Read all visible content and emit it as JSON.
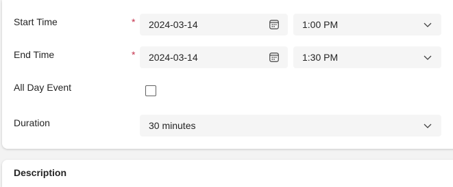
{
  "form": {
    "start_time": {
      "label": "Start Time",
      "required_mark": "*",
      "date": "2024-03-14",
      "time": "1:00 PM"
    },
    "end_time": {
      "label": "End Time",
      "required_mark": "*",
      "date": "2024-03-14",
      "time": "1:30 PM"
    },
    "all_day": {
      "label": "All Day Event",
      "checked": false
    },
    "duration": {
      "label": "Duration",
      "value": "30 minutes"
    }
  },
  "description": {
    "label": "Description"
  },
  "icons": {
    "calendar": "calendar-icon",
    "dropdown": "chevron-down-icon"
  },
  "colors": {
    "required": "#c4314b",
    "field_bg": "#f5f5f5"
  }
}
